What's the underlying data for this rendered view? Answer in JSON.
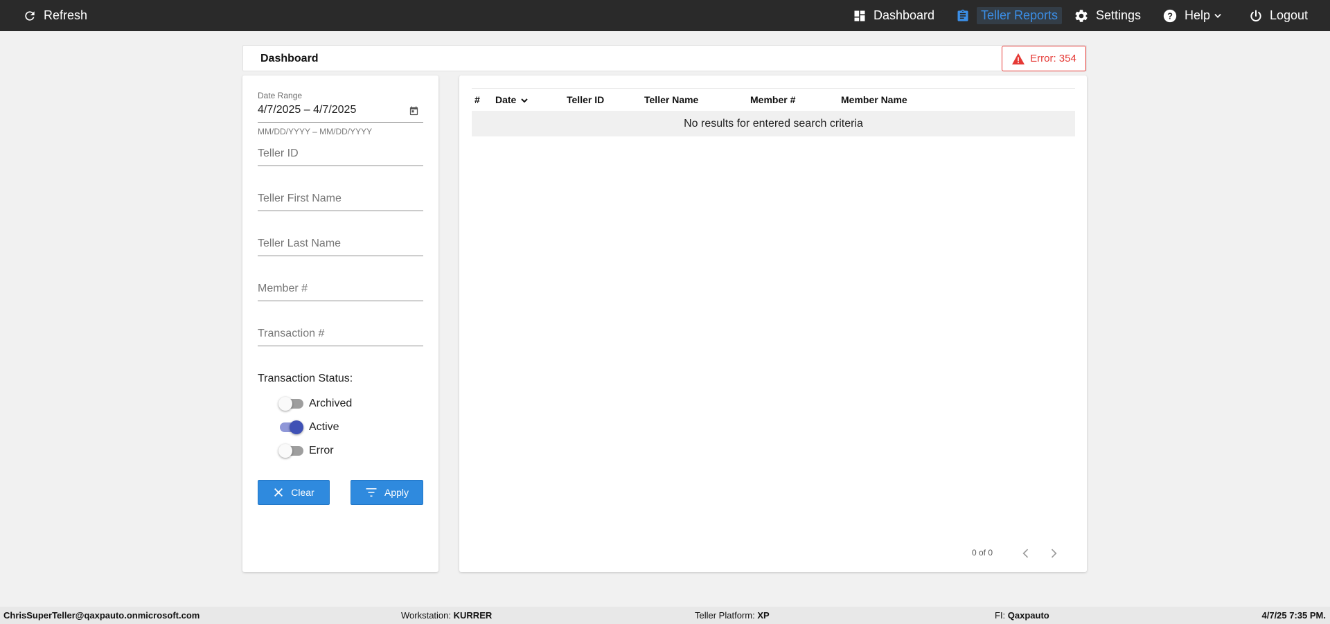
{
  "topbar": {
    "refresh_label": "Refresh",
    "nav": {
      "dashboard": "Dashboard",
      "teller_reports": "Teller Reports",
      "settings": "Settings",
      "help": "Help",
      "logout": "Logout"
    },
    "active_item": "teller_reports",
    "accent_color": "#3b8ee6"
  },
  "header": {
    "title": "Dashboard",
    "error_badge": "Error: 354",
    "error_color": "#e53935"
  },
  "filters": {
    "date_range_label": "Date Range",
    "date_range_value": "4/7/2025 – 4/7/2025",
    "date_range_hint": "MM/DD/YYYY – MM/DD/YYYY",
    "teller_id_placeholder": "Teller ID",
    "teller_first_name_placeholder": "Teller First Name",
    "teller_last_name_placeholder": "Teller Last Name",
    "member_number_placeholder": "Member #",
    "transaction_number_placeholder": "Transaction #",
    "status_title": "Transaction Status:",
    "statuses": [
      {
        "label": "Archived",
        "on": false
      },
      {
        "label": "Active",
        "on": true
      },
      {
        "label": "Error",
        "on": false
      }
    ],
    "clear_label": "Clear",
    "apply_label": "Apply",
    "button_color": "#2f8ade"
  },
  "results": {
    "columns": [
      "#",
      "Date",
      "Teller ID",
      "Teller Name",
      "Member #",
      "Member Name"
    ],
    "sort_column": "Date",
    "empty_message": "No results for entered search criteria",
    "pagination": "0 of 0"
  },
  "footer": {
    "user": "ChrisSuperTeller@qaxpauto.onmicrosoft.com",
    "workstation_label": "Workstation:",
    "workstation": "KURRER",
    "platform_label": "Teller Platform:",
    "platform": "XP",
    "fi_label": "FI:",
    "fi": "Qaxpauto",
    "datetime": "4/7/25 7:35 PM."
  }
}
